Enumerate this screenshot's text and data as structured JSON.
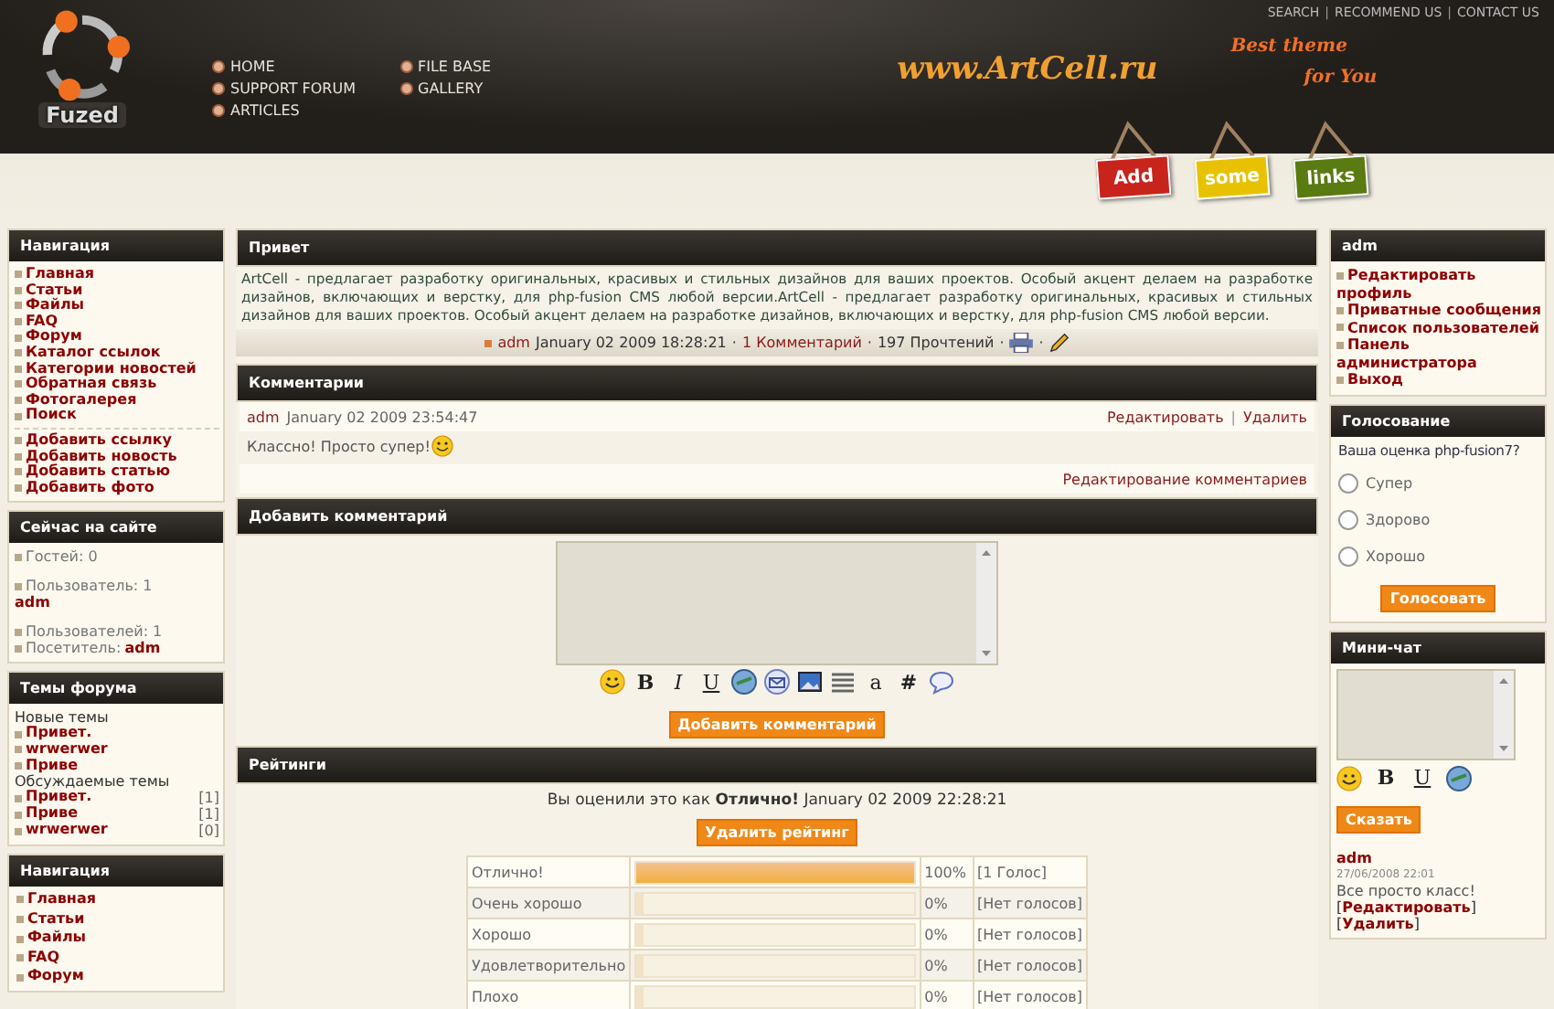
{
  "header": {
    "logo_text": "Fuzed",
    "top_links": [
      "SEARCH",
      "RECOMMEND US",
      "CONTACT US"
    ],
    "top_separator": "|",
    "nav_columns": [
      [
        "HOME",
        "SUPPORT FORUM",
        "ARTICLES"
      ],
      [
        "FILE BASE",
        "GALLERY"
      ]
    ],
    "site": "www.ArtCell.ru",
    "slogan": [
      "Best theme",
      "for You"
    ],
    "signs": [
      {
        "label": "Add",
        "color": "#c8241c"
      },
      {
        "label": "some",
        "color": "#e8c200"
      },
      {
        "label": "links",
        "color": "#5a7a12"
      }
    ]
  },
  "left": {
    "navigation": {
      "title": "Навигация",
      "groups": [
        [
          "Главная",
          "Статьи",
          "Файлы",
          "FAQ",
          "Форум",
          "Каталог ссылок",
          "Категории новостей",
          "Обратная связь",
          "Фотогалерея",
          "Поиск"
        ],
        [
          "Добавить ссылку",
          "Добавить новость",
          "Добавить статью",
          "Добавить фото"
        ]
      ]
    },
    "online": {
      "title": "Сейчас на сайте",
      "groups": [
        [
          {
            "kind": "stat",
            "text": "Гостей: 0"
          }
        ],
        [
          {
            "kind": "stat",
            "text": "Пользователь: 1"
          },
          {
            "kind": "user",
            "text": "adm"
          }
        ],
        [
          {
            "kind": "stat",
            "text": "Пользователей: 1"
          },
          {
            "kind": "stat",
            "text": "Посетитель:",
            "user": "adm"
          }
        ]
      ]
    },
    "forum": {
      "title": "Темы форума",
      "sections": [
        {
          "heading": "Новые темы",
          "topics": [
            {
              "title": "Привет."
            },
            {
              "title": "wrwerwer"
            },
            {
              "title": "Приве"
            }
          ]
        },
        {
          "heading": "Обсуждаемые темы",
          "topics": [
            {
              "title": "Привет.",
              "count": "[1]"
            },
            {
              "title": "Приве",
              "count": "[1]"
            },
            {
              "title": "wrwerwer",
              "count": "[0]"
            }
          ]
        }
      ]
    },
    "navigation_2": {
      "title": "Навигация",
      "items": [
        "Главная",
        "Статьи",
        "Файлы",
        "FAQ",
        "Форум"
      ]
    }
  },
  "article": {
    "title": "Привет",
    "body": "ArtCell - предлагает разработку оригинальных, красивых и стильных дизайнов для ваших проектов. Особый акцент делаем на разработке дизайнов, включающих и верстку, для php-fusion CMS любой версии.ArtCell - предлагает разработку оригинальных, красивых и стильных дизайнов для ваших проектов. Особый акцент делаем на разработке дизайнов, включающих и верстку, для php-fusion CMS любой версии.",
    "meta": {
      "author": "adm",
      "date": "January 02 2009 18:28:21",
      "comments": "1 Комментарий",
      "reads": "197 Прочтений",
      "separator": "·"
    }
  },
  "comments": {
    "title": "Комментарии",
    "items": [
      {
        "author": "adm",
        "date": "January 02 2009 23:54:47",
        "actions": [
          "Редактировать",
          "Удалить"
        ],
        "action_separator": "|",
        "text": "Классно! Просто супер!"
      }
    ],
    "footer_link": "Редактирование комментариев"
  },
  "add_comment": {
    "title": "Добавить комментарий",
    "toolbar": [
      {
        "kind": "smiley"
      },
      {
        "kind": "bold",
        "label": "B"
      },
      {
        "kind": "italic",
        "label": "I"
      },
      {
        "kind": "underline",
        "label": "U"
      },
      {
        "kind": "link"
      },
      {
        "kind": "mail"
      },
      {
        "kind": "image"
      },
      {
        "kind": "align"
      },
      {
        "kind": "char",
        "label": "a"
      },
      {
        "kind": "bold",
        "label": "#"
      },
      {
        "kind": "quote"
      }
    ],
    "button": "Добавить комментарий"
  },
  "ratings": {
    "title": "Рейтинги",
    "notice": "Вы оценили это как **Отлично!** January 02 2009 22:28:21",
    "button": "Удалить рейтинг",
    "rows": [
      {
        "label": "Отлично!",
        "level": 1,
        "percent": "100%",
        "votes": "[1 Голос]"
      },
      {
        "label": "Очень хорошо",
        "level": 0,
        "percent": "0%",
        "votes": "[Нет голосов]"
      },
      {
        "label": "Хорошо",
        "level": 0,
        "percent": "0%",
        "votes": "[Нет голосов]"
      },
      {
        "label": "Удовлетворительно",
        "level": 0,
        "percent": "0%",
        "votes": "[Нет голосов]"
      },
      {
        "label": "Плохо",
        "level": 0,
        "percent": "0%",
        "votes": "[Нет голосов]"
      }
    ]
  },
  "user_panel": {
    "title": "adm",
    "links": [
      "Редактировать профиль",
      "Приватные сообщения",
      "Список пользователей",
      "Панель администратора",
      "Выход"
    ]
  },
  "poll": {
    "title": "Голосование",
    "question": "Ваша оценка php-fusion7?",
    "options": [
      {
        "label": "Супер",
        "selected": false
      },
      {
        "label": "Здорово",
        "selected": false
      },
      {
        "label": "Хорошо",
        "selected": false
      }
    ],
    "button": "Голосовать"
  },
  "shoutbox": {
    "title": "Мини-чат",
    "toolbar": [
      {
        "kind": "smiley"
      },
      {
        "kind": "bold",
        "label": "B"
      },
      {
        "kind": "underline",
        "label": "U"
      },
      {
        "kind": "link"
      }
    ],
    "button": "Сказать",
    "posts": [
      {
        "author": "adm",
        "date": "27/06/2008 22:01",
        "text": "Все просто класс!",
        "links": [
          {
            "open": "[",
            "label": "Редактировать",
            "close": "]"
          },
          {
            "open": "[",
            "label": "Удалить",
            "close": "]"
          }
        ]
      }
    ]
  }
}
